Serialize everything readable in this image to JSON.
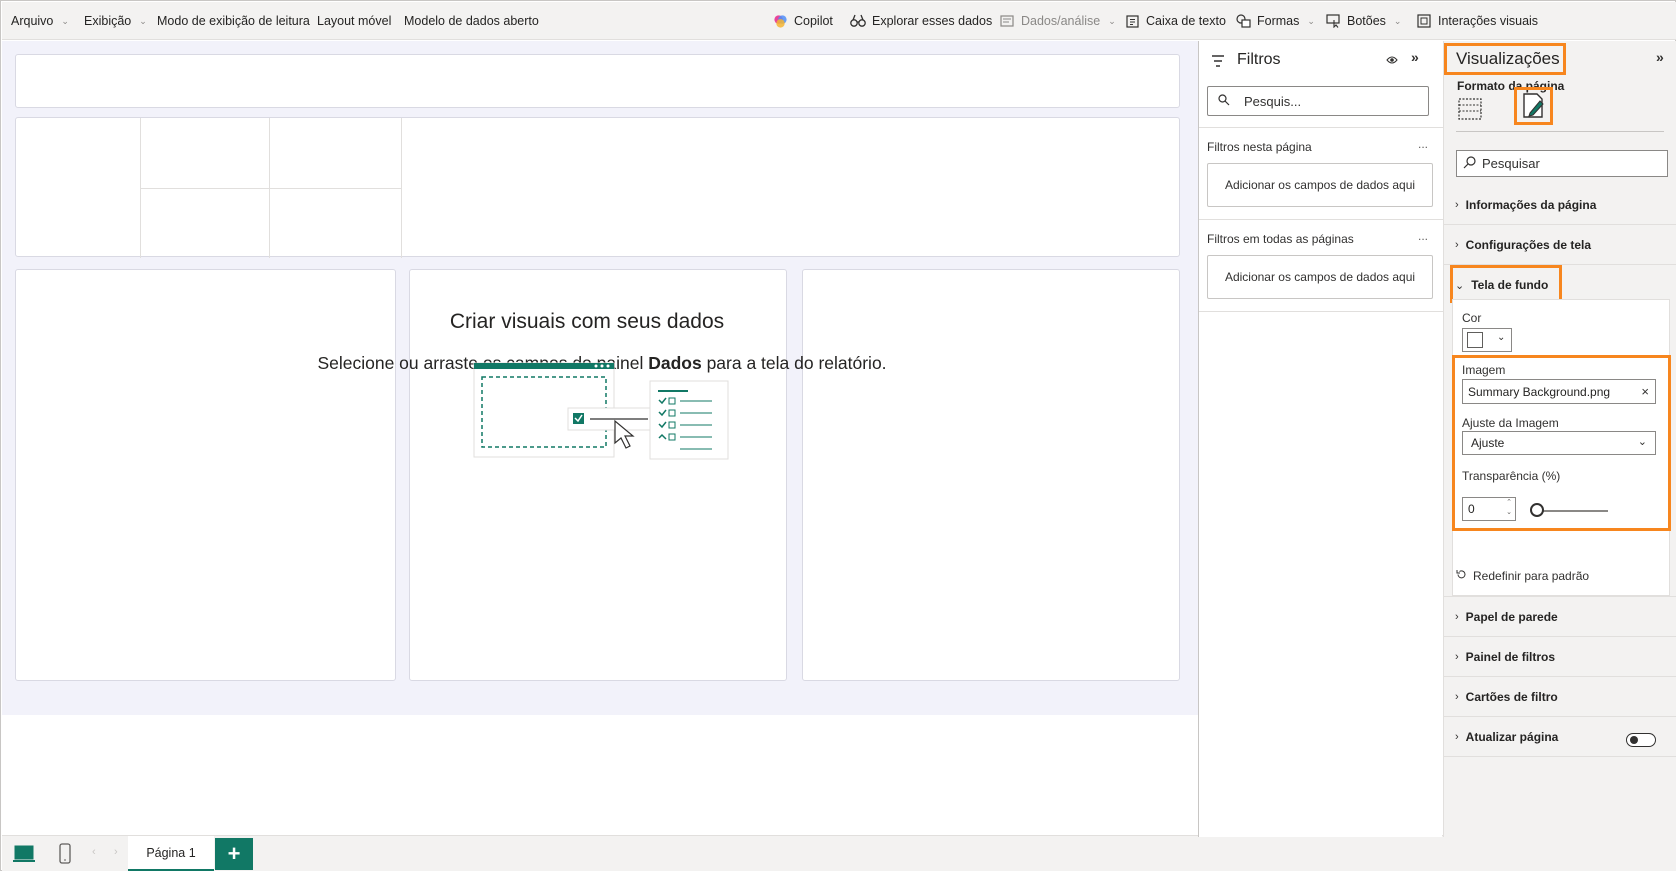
{
  "ribbon": {
    "arquivo": "Arquivo",
    "exibicao": "Exibição",
    "modo_leitura": "Modo de exibição de leitura",
    "layout_movel": "Layout móvel",
    "modelo_dados": "Modelo de dados aberto",
    "copilot": "Copilot",
    "explorar": "Explorar esses dados",
    "dados_analise": "Dados/análise",
    "caixa_texto": "Caixa de texto",
    "formas": "Formas",
    "botoes": "Botões",
    "interacoes": "Interações visuais"
  },
  "canvas": {
    "empty_title": "Criar visuais com seus dados",
    "empty_sub_pre": "Selecione ou arraste os campos do painel ",
    "empty_sub_bold": "Dados",
    "empty_sub_post": " para a tela do relatório."
  },
  "bottom": {
    "page_tab": "Página 1",
    "add_tab": "+"
  },
  "filters": {
    "title": "Filtros",
    "search_placeholder": "Pesquis...",
    "this_page_label": "Filtros nesta página",
    "this_page_drop": "Adicionar os campos de dados aqui",
    "all_pages_label": "Filtros em todas as páginas",
    "all_pages_drop": "Adicionar os campos de dados aqui",
    "more": "..."
  },
  "viz": {
    "title": "Visualizações",
    "subtitle": "Formato da página",
    "search_placeholder": "Pesquisar",
    "sections": {
      "informacoes": "Informações da página",
      "configuracoes": "Configurações de tela",
      "tela_fundo": "Tela de fundo",
      "papel_parede": "Papel de parede",
      "painel_filtros": "Painel de filtros",
      "cartoes_filtro": "Cartões de filtro",
      "atualizar": "Atualizar página"
    },
    "background": {
      "cor_label": "Cor",
      "imagem_label": "Imagem",
      "imagem_value": "Summary Background.png",
      "ajuste_label": "Ajuste da Imagem",
      "ajuste_value": "Ajuste",
      "transparencia_label": "Transparência (%)",
      "transparencia_value": "0",
      "reset_label": "Redefinir para padrão"
    }
  },
  "colors": {
    "accent": "#117865",
    "highlight": "#f7861e"
  }
}
